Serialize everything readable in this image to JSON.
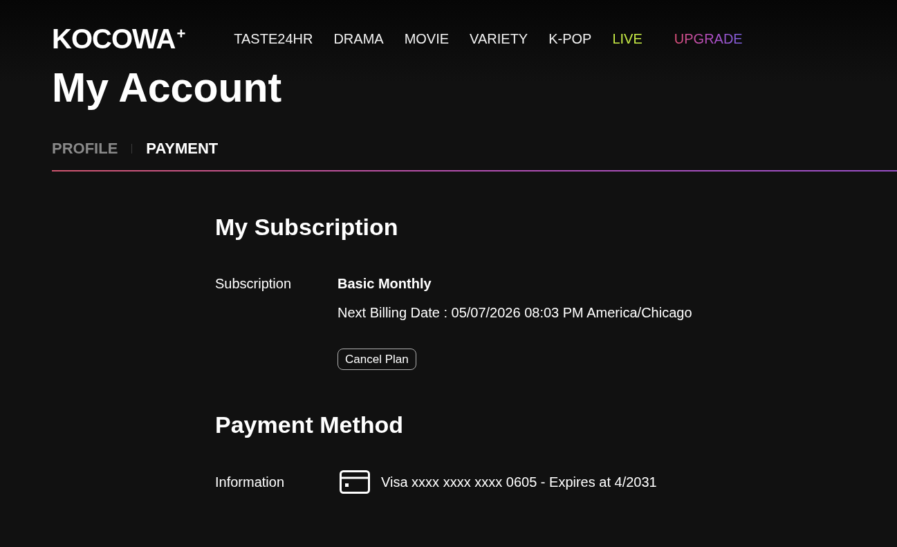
{
  "header": {
    "logo": "KOCOWA$^{+}$",
    "nav": [
      {
        "label": "TASTE24HR",
        "kind": "plain"
      },
      {
        "label": "DRAMA",
        "kind": "plain"
      },
      {
        "label": "MOVIE",
        "kind": "plain"
      },
      {
        "label": "VARIETY",
        "kind": "plain"
      },
      {
        "label": "K-POP",
        "kind": "plain"
      },
      {
        "label": "LIVE",
        "kind": "live"
      },
      {
        "label": "UPGRADE",
        "kind": "upgrade"
      }
    ]
  },
  "page_title": "My Account",
  "tabs": [
    {
      "label": "PROFILE",
      "selected": false
    },
    {
      "label": "PAYMENT",
      "selected": true
    }
  ],
  "subscription": {
    "title": "My Subscription",
    "label": "Subscription",
    "plan": "Basic Monthly",
    "next_billing": "Next Billing Date : 05/07/2026 08:03 PM America/Chicago",
    "cancel_button": "Cancel Plan"
  },
  "payment_method": {
    "title": "Payment Method",
    "label": "Information",
    "card": "Visa xxxx xxxx xxxx 0605 - Expires at 4/2031"
  }
}
